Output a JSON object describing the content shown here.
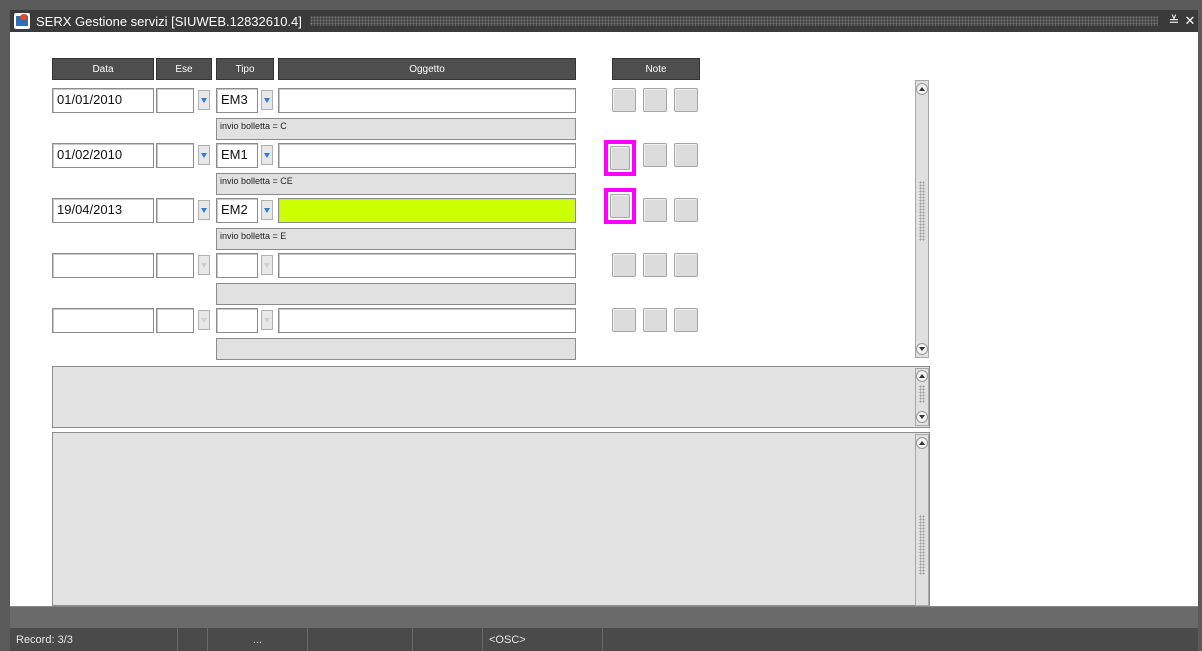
{
  "window": {
    "title": "SERX Gestione servizi [SIUWEB.12832610.4]",
    "controls": {
      "restore": "≚",
      "close": "✕"
    }
  },
  "columns": {
    "data": "Data",
    "ese": "Ese",
    "tipo": "Tipo",
    "oggetto": "Oggetto",
    "note": "Note"
  },
  "rows": [
    {
      "data": "01/01/2010",
      "ese": "",
      "tipo": "EM3",
      "oggetto": "",
      "descrizione": "invio bolletta = C"
    },
    {
      "data": "01/02/2010",
      "ese": "",
      "tipo": "EM1",
      "oggetto": "",
      "descrizione": "invio bolletta = CE"
    },
    {
      "data": "19/04/2013",
      "ese": "",
      "tipo": "EM2",
      "oggetto": "",
      "descrizione": "invio bolletta = E"
    },
    {
      "data": "",
      "ese": "",
      "tipo": "",
      "oggetto": "",
      "descrizione": ""
    },
    {
      "data": "",
      "ese": "",
      "tipo": "",
      "oggetto": "",
      "descrizione": ""
    }
  ],
  "status": {
    "record": "Record: 3/3",
    "seg3": "...",
    "mode": "<OSC>"
  },
  "colors": {
    "highlight": "#ccff00",
    "focus_ring": "#ff00ff",
    "header_bg": "#4e4e4e",
    "statusbar_bg": "#4a4a4a"
  }
}
